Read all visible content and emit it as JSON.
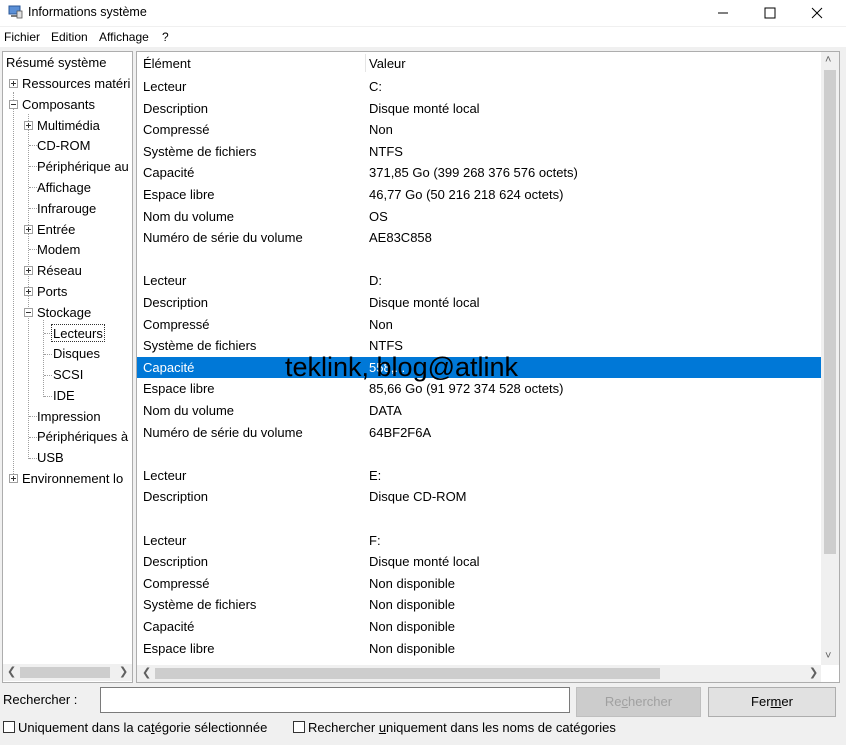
{
  "window": {
    "title": "Informations système"
  },
  "menu": [
    "Fichier",
    "Edition",
    "Affichage",
    "?"
  ],
  "tree": [
    {
      "label": "Résumé système"
    },
    {
      "label": "Ressources matéri"
    },
    {
      "label": "Composants"
    },
    {
      "label": "Multimédia"
    },
    {
      "label": "CD-ROM"
    },
    {
      "label": "Périphérique au"
    },
    {
      "label": "Affichage"
    },
    {
      "label": "Infrarouge"
    },
    {
      "label": "Entrée"
    },
    {
      "label": "Modem"
    },
    {
      "label": "Réseau"
    },
    {
      "label": "Ports"
    },
    {
      "label": "Stockage"
    },
    {
      "label": "Lecteurs"
    },
    {
      "label": "Disques"
    },
    {
      "label": "SCSI"
    },
    {
      "label": "IDE"
    },
    {
      "label": "Impression"
    },
    {
      "label": "Périphériques à"
    },
    {
      "label": "USB"
    },
    {
      "label": "Environnement lo"
    }
  ],
  "table": {
    "columns": [
      "Élément",
      "Valeur"
    ],
    "rows": [
      [
        "Lecteur",
        "C:"
      ],
      [
        "Description",
        "Disque monté local"
      ],
      [
        "Compressé",
        "Non"
      ],
      [
        "Système de fichiers",
        "NTFS"
      ],
      [
        "Capacité",
        "371,85 Go (399 268 376 576 octets)"
      ],
      [
        "Espace libre",
        "46,77 Go (50 216 218 624 octets)"
      ],
      [
        "Nom du volume",
        "OS"
      ],
      [
        "Numéro de série du volume",
        "AE83C858"
      ],
      [
        "",
        ""
      ],
      [
        "Lecteur",
        "D:"
      ],
      [
        "Description",
        "Disque monté local"
      ],
      [
        "Compressé",
        "Non"
      ],
      [
        "Système de fichiers",
        "NTFS"
      ],
      [
        "Capacité",
        "558,..."
      ],
      [
        "Espace libre",
        "85,66 Go (91 972 374 528 octets)"
      ],
      [
        "Nom du volume",
        "DATA"
      ],
      [
        "Numéro de série du volume",
        "64BF2F6A"
      ],
      [
        "",
        ""
      ],
      [
        "Lecteur",
        "E:"
      ],
      [
        "Description",
        "Disque CD-ROM"
      ],
      [
        "",
        ""
      ],
      [
        "Lecteur",
        "F:"
      ],
      [
        "Description",
        "Disque monté local"
      ],
      [
        "Compressé",
        "Non disponible"
      ],
      [
        "Système de fichiers",
        "Non disponible"
      ],
      [
        "Capacité",
        "Non disponible"
      ],
      [
        "Espace libre",
        "Non disponible"
      ]
    ]
  },
  "watermark": "teklink, blog@atlink",
  "search": {
    "label": "Rechercher :",
    "value": "",
    "search_button_pre": "Re",
    "search_button_ul": "c",
    "search_button_post": "hercher",
    "close_button_pre": "Fer",
    "close_button_ul": "m",
    "close_button_post": "er"
  },
  "options": {
    "only_selected_pre": "Uniquement dans la ca",
    "only_selected_ul": "t",
    "only_selected_post": "égorie sélectionnée",
    "names_only_pre": "Rechercher ",
    "names_only_ul": "u",
    "names_only_post": "niquement dans les noms de catégories"
  },
  "colors": {
    "selection": "#0078d7"
  }
}
